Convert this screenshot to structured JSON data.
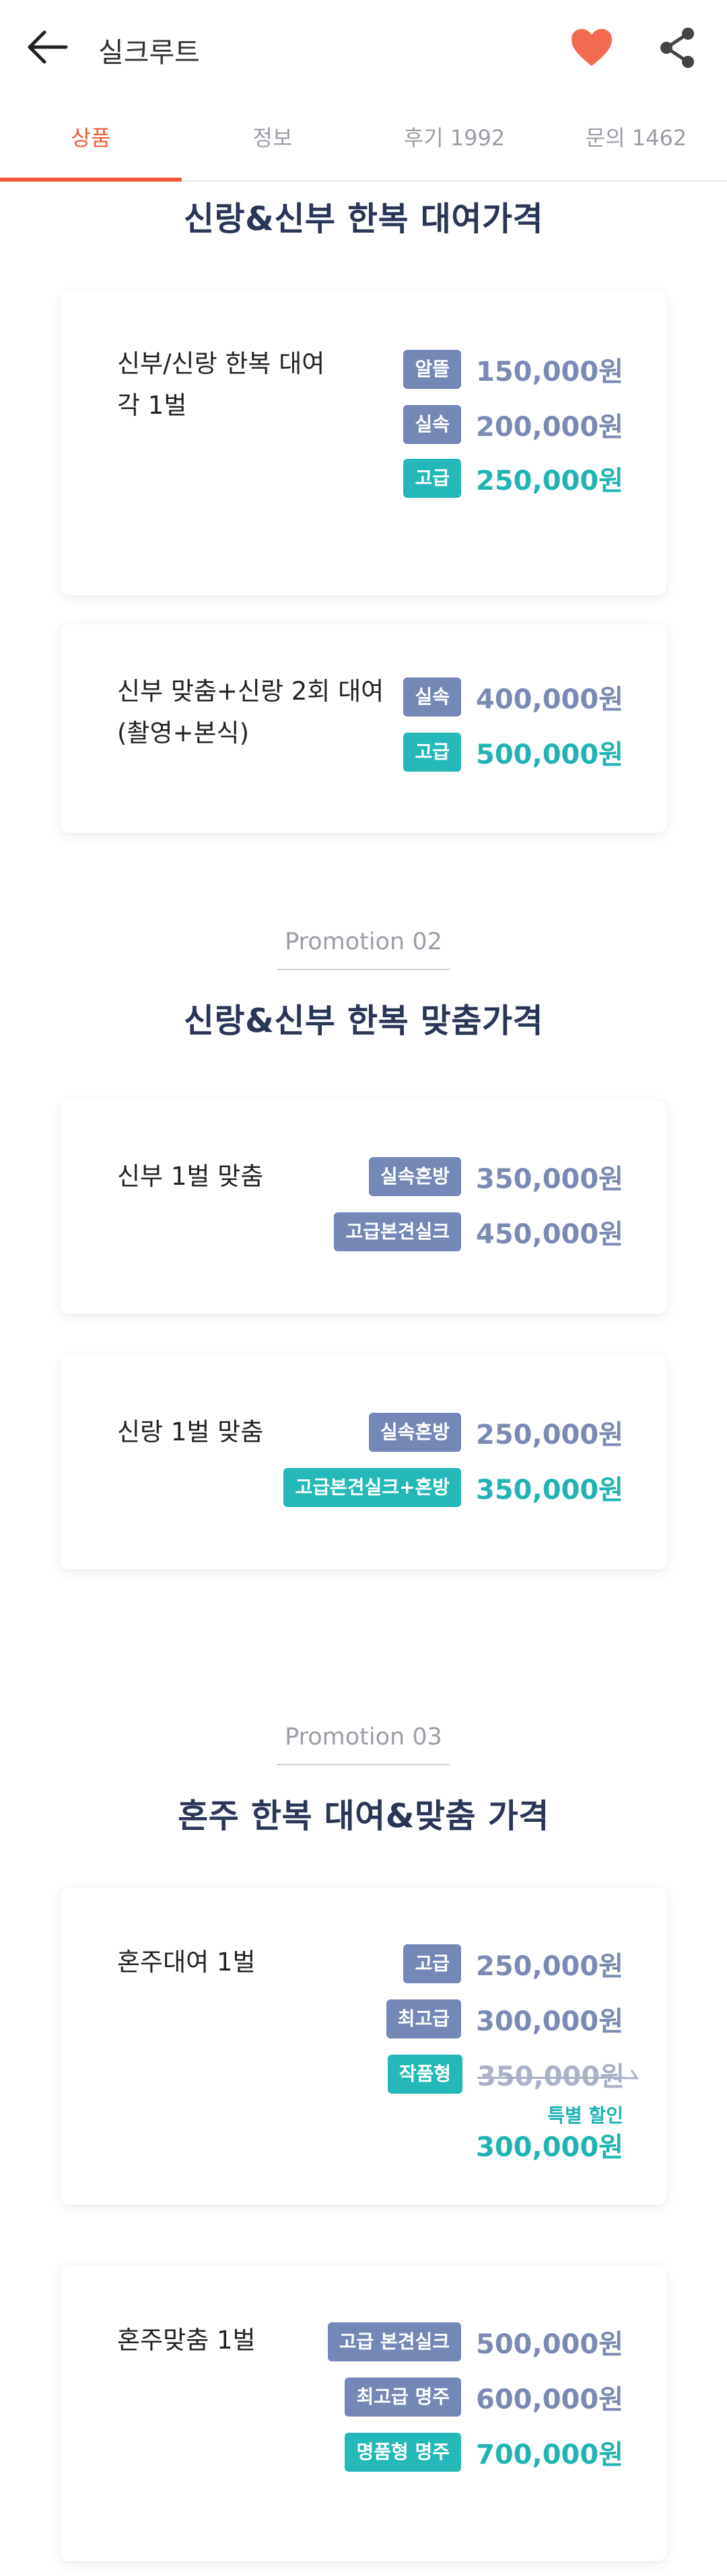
{
  "header": {
    "title": "실크루트",
    "favorite_color": "#f26b50"
  },
  "tabs": [
    {
      "label": "상품",
      "active": true
    },
    {
      "label": "정보",
      "active": false
    },
    {
      "label": "후기 1992",
      "active": false
    },
    {
      "label": "문의 1462",
      "active": false
    }
  ],
  "sections": {
    "rental": {
      "title": "신랑&신부 한복 대여가격",
      "cards": [
        {
          "label_lines": [
            "신부/신랑 한복 대여",
            "각 1벌"
          ],
          "prices": [
            {
              "badge": "알뜰",
              "price": "150,000원",
              "style": "blue"
            },
            {
              "badge": "실속",
              "price": "200,000원",
              "style": "blue"
            },
            {
              "badge": "고급",
              "price": "250,000원",
              "style": "teal"
            }
          ]
        },
        {
          "label_lines": [
            "신부 맞춤+신랑 2회 대여",
            "(촬영+본식)"
          ],
          "prices": [
            {
              "badge": "실속",
              "price": "400,000원",
              "style": "blue"
            },
            {
              "badge": "고급",
              "price": "500,000원",
              "style": "teal"
            }
          ]
        }
      ]
    },
    "custom": {
      "promo": "Promotion 02",
      "title": "신랑&신부 한복 맞춤가격",
      "cards": [
        {
          "label_lines": [
            "신부 1벌 맞춤"
          ],
          "prices": [
            {
              "badge": "실속혼방",
              "price": "350,000원",
              "style": "blue"
            },
            {
              "badge": "고급본견실크",
              "price": "450,000원",
              "style": "blue"
            }
          ]
        },
        {
          "label_lines": [
            "신랑 1벌 맞춤"
          ],
          "prices": [
            {
              "badge": "실속혼방",
              "price": "250,000원",
              "style": "blue"
            },
            {
              "badge": "고급본견실크+혼방",
              "price": "350,000원",
              "style": "teal"
            }
          ]
        }
      ]
    },
    "parents": {
      "promo": "Promotion 03",
      "title": "혼주 한복 대여&맞춤 가격",
      "cards": [
        {
          "label_lines": [
            "혼주대여 1벌"
          ],
          "prices": [
            {
              "badge": "고급",
              "price": "250,000원",
              "style": "blue"
            },
            {
              "badge": "최고급",
              "price": "300,000원",
              "style": "blue"
            },
            {
              "badge": "작품형",
              "price": "350,000원",
              "style": "strike"
            }
          ],
          "discount_label": "특별 할인",
          "discount_price": "300,000원"
        },
        {
          "label_lines": [
            "혼주맞춤 1벌"
          ],
          "prices": [
            {
              "badge": "고급 본견실크",
              "price": "500,000원",
              "style": "blue"
            },
            {
              "badge": "최고급 명주",
              "price": "600,000원",
              "style": "blue"
            },
            {
              "badge": "명품형 명주",
              "price": "700,000원",
              "style": "teal"
            }
          ]
        }
      ]
    }
  }
}
